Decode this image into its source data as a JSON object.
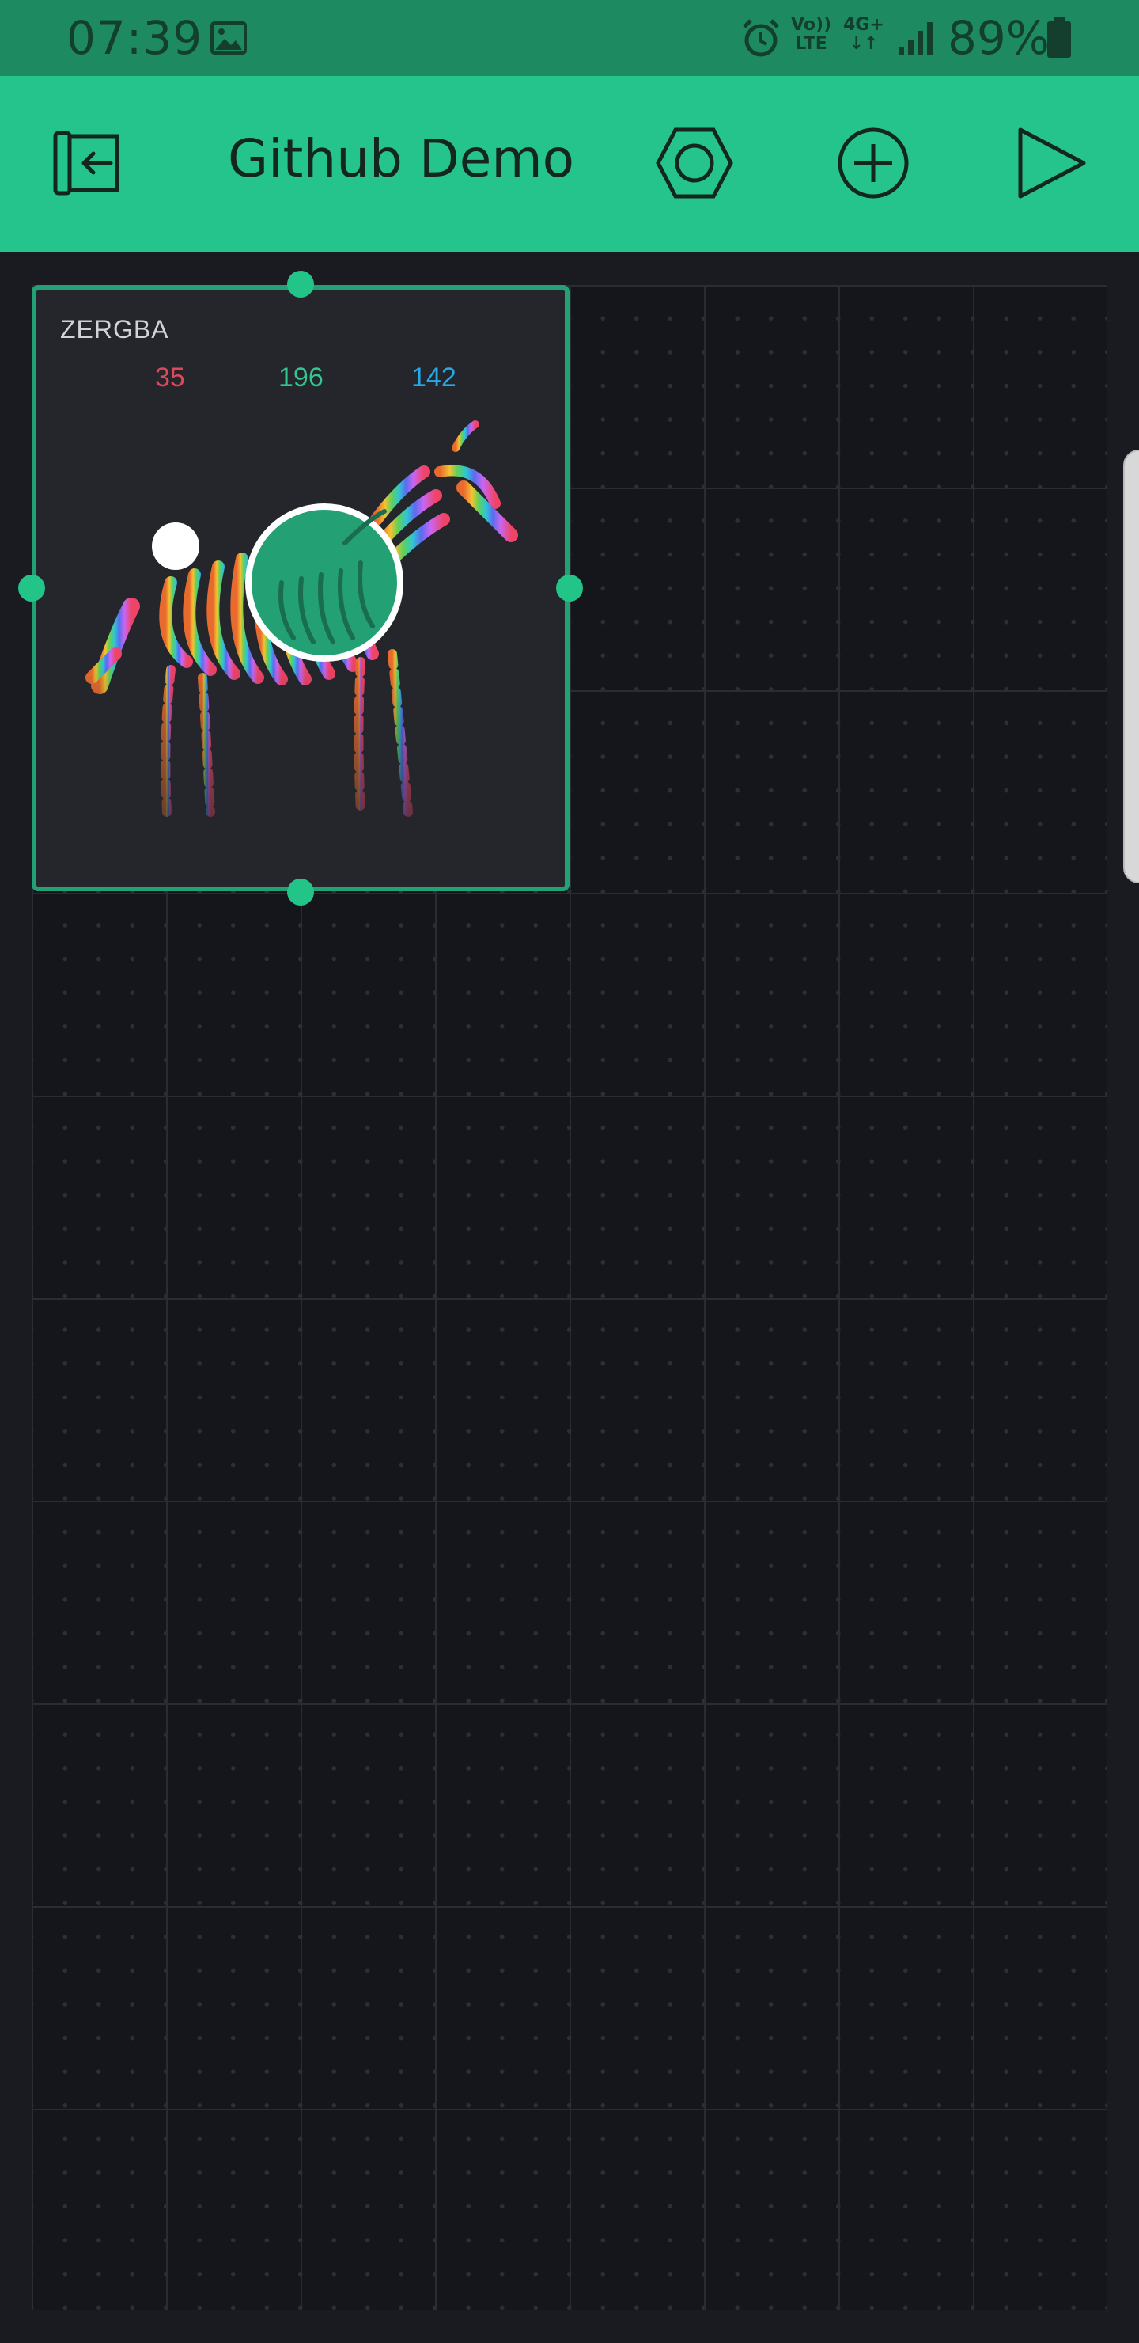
{
  "status_bar": {
    "time": "07:39",
    "volte_top": "Vo))",
    "volte_bottom": "LTE",
    "network_top": "4G+",
    "network_bottom": "↓↑",
    "battery": "89%"
  },
  "header": {
    "title": "Github Demo"
  },
  "widget": {
    "label": "ZERGBA",
    "red": "35",
    "green": "196",
    "blue": "142",
    "colors": {
      "red": "#e0475b",
      "green": "#31c88f",
      "blue": "#27a9e8",
      "selected": "#23a074"
    }
  },
  "theme": {
    "header": "#25c48d",
    "status": "#1d8a62",
    "canvas": "#15161b"
  }
}
